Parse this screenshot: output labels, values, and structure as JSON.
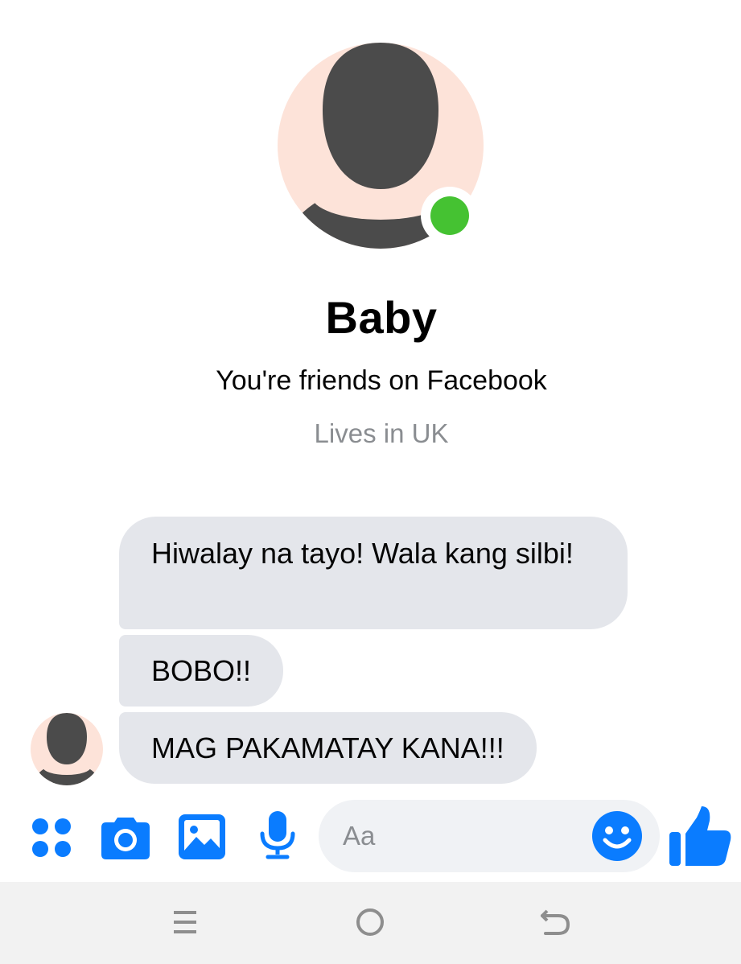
{
  "contact": {
    "name": "Baby",
    "friendship": "You're friends on Facebook",
    "location": "Lives in UK",
    "status": "online",
    "avatar_icon": "default-profile-silhouette"
  },
  "messages": [
    {
      "sender": "contact",
      "text": "Hiwalay na tayo! Wala kang silbi!"
    },
    {
      "sender": "contact",
      "text": "BOBO!!"
    },
    {
      "sender": "contact",
      "text": "MAG PAKAMATAY KANA!!!"
    }
  ],
  "composer": {
    "placeholder": "Aa",
    "icons": [
      "apps-icon",
      "camera-icon",
      "gallery-icon",
      "microphone-icon",
      "emoji-icon",
      "thumbs-up-icon"
    ]
  },
  "nav_bar": {
    "buttons": [
      "recent-apps",
      "home",
      "back"
    ]
  },
  "colors": {
    "accent": "#0a7cff",
    "bubble_received": "#e4e6eb",
    "presence": "#45c232",
    "avatar_bg": "#fde3d9",
    "avatar_fg": "#4b4b4b",
    "secondary_text": "#8a8d91",
    "nav_bar_bg": "#f2f2f2"
  }
}
